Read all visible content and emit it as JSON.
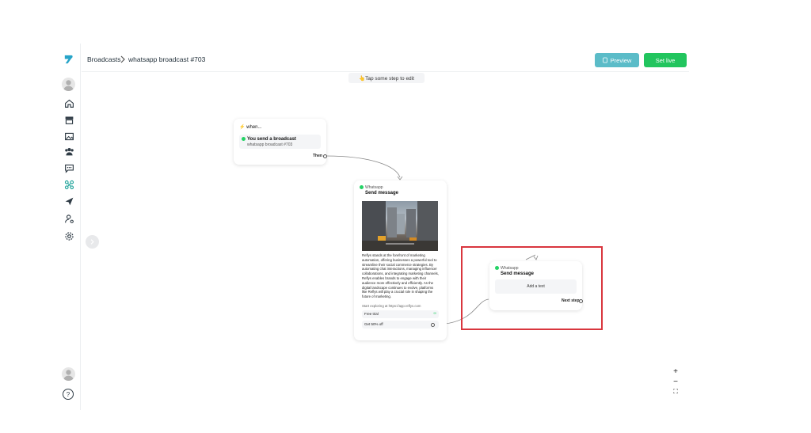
{
  "header": {
    "breadcrumb_root": "Broadcasts",
    "breadcrumb_current": "whatsapp broadcast #703",
    "preview_label": "Preview",
    "set_live_label": "Set live",
    "colors": {
      "preview": "#5bbcc8",
      "set_live": "#22c55e"
    }
  },
  "hint": {
    "text": "👆Tap some step to edit"
  },
  "sidebar": {
    "icons": [
      "home-icon",
      "store-icon",
      "image-icon",
      "users-icon",
      "chat-icon",
      "flow-icon",
      "send-icon",
      "user-settings-icon",
      "gear-icon"
    ]
  },
  "trigger_node": {
    "header": "when...",
    "event_title": "You send a broadcast",
    "event_subtitle": "whatsapp broadcast #703",
    "port_label": "Then"
  },
  "message_node": {
    "channel": "Whatsapp",
    "title": "Send message",
    "body": "Reflys stands at the forefront of marketing automation, offering businesses a powerful tool to streamline their social commerce strategies. By automating chat interactions, managing influencer collaborations, and integrating marketing channels, Reflys enables brands to engage with their audience more effectively and efficiently. As the digital landscape continues to evolve, platforms like Reflys will play a crucial role in shaping the future of marketing.",
    "link_text": "Start exploring at https://app.reflys.com",
    "buttons": [
      "Free trial",
      "Get 50% off"
    ]
  },
  "new_node": {
    "channel": "Whatsapp",
    "title": "Send message",
    "add_text_label": "Add a text",
    "port_label": "Next step"
  },
  "zoom_controls": {
    "zoom_in": "+",
    "zoom_out": "−",
    "fit": "⛶"
  }
}
